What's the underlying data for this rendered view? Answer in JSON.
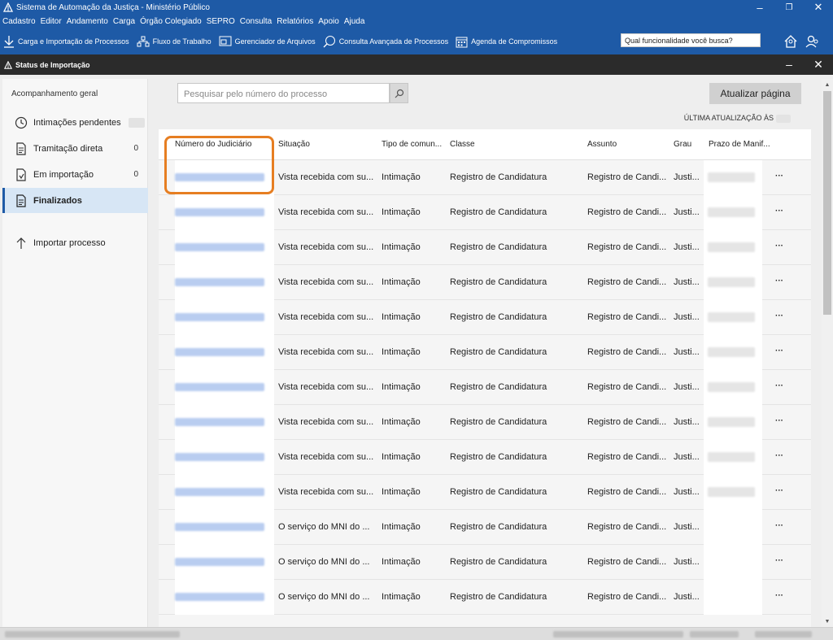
{
  "window": {
    "title": "Sistema de Automação da Justiça - Ministério Público",
    "minimize": "–",
    "maximize": "❐",
    "close": "✕"
  },
  "menu": {
    "items": [
      "Cadastro",
      "Editor",
      "Andamento",
      "Carga",
      "Órgão Colegiado",
      "SEPRO",
      "Consulta",
      "Relatórios",
      "Apoio",
      "Ajuda"
    ]
  },
  "toolbar": {
    "items": [
      {
        "label": "Carga e Importação de Processos",
        "icon": "download-icon"
      },
      {
        "label": "Fluxo de Trabalho",
        "icon": "workflow-icon"
      },
      {
        "label": "Gerenciador de Arquivos",
        "icon": "file-manager-icon"
      },
      {
        "label": "Consulta Avançada de Processos",
        "icon": "search-chat-icon"
      },
      {
        "label": "Agenda de Compromissos",
        "icon": "calendar-icon"
      }
    ],
    "search_placeholder": "Qual funcionalidade você busca?"
  },
  "panel": {
    "title": "Status de Importação",
    "minimize": "–",
    "close": "✕"
  },
  "sidebar": {
    "header": "Acompanhamento geral",
    "items": [
      {
        "label": "Intimações pendentes",
        "count": "",
        "icon": "clock-icon"
      },
      {
        "label": "Tramitação direta",
        "count": "0",
        "icon": "document-icon"
      },
      {
        "label": "Em importação",
        "count": "0",
        "icon": "document-import-icon"
      },
      {
        "label": "Finalizados",
        "count": "",
        "icon": "document-check-icon",
        "active": true
      }
    ],
    "import_label": "Importar processo"
  },
  "main": {
    "search_placeholder": "Pesquisar pelo número do processo",
    "refresh_label": "Atualizar página",
    "last_update_label": "ÚLTIMA ATUALIZAÇÃO ÀS"
  },
  "table": {
    "columns": [
      "Número do Judiciário",
      "Situação",
      "Tipo de comun...",
      "Classe",
      "Assunto",
      "Grau",
      "Prazo de Manif..."
    ],
    "rows": [
      {
        "situacao": "Vista recebida com su...",
        "tipo": "Intimação",
        "classe": "Registro de Candidatura",
        "assunto": "Registro de Candi...",
        "grau": "Justi...",
        "has_prazo": true
      },
      {
        "situacao": "Vista recebida com su...",
        "tipo": "Intimação",
        "classe": "Registro de Candidatura",
        "assunto": "Registro de Candi...",
        "grau": "Justi...",
        "has_prazo": true
      },
      {
        "situacao": "Vista recebida com su...",
        "tipo": "Intimação",
        "classe": "Registro de Candidatura",
        "assunto": "Registro de Candi...",
        "grau": "Justi...",
        "has_prazo": true
      },
      {
        "situacao": "Vista recebida com su...",
        "tipo": "Intimação",
        "classe": "Registro de Candidatura",
        "assunto": "Registro de Candi...",
        "grau": "Justi...",
        "has_prazo": true
      },
      {
        "situacao": "Vista recebida com su...",
        "tipo": "Intimação",
        "classe": "Registro de Candidatura",
        "assunto": "Registro de Candi...",
        "grau": "Justi...",
        "has_prazo": true
      },
      {
        "situacao": "Vista recebida com su...",
        "tipo": "Intimação",
        "classe": "Registro de Candidatura",
        "assunto": "Registro de Candi...",
        "grau": "Justi...",
        "has_prazo": true
      },
      {
        "situacao": "Vista recebida com su...",
        "tipo": "Intimação",
        "classe": "Registro de Candidatura",
        "assunto": "Registro de Candi...",
        "grau": "Justi...",
        "has_prazo": true
      },
      {
        "situacao": "Vista recebida com su...",
        "tipo": "Intimação",
        "classe": "Registro de Candidatura",
        "assunto": "Registro de Candi...",
        "grau": "Justi...",
        "has_prazo": true
      },
      {
        "situacao": "Vista recebida com su...",
        "tipo": "Intimação",
        "classe": "Registro de Candidatura",
        "assunto": "Registro de Candi...",
        "grau": "Justi...",
        "has_prazo": true
      },
      {
        "situacao": "Vista recebida com su...",
        "tipo": "Intimação",
        "classe": "Registro de Candidatura",
        "assunto": "Registro de Candi...",
        "grau": "Justi...",
        "has_prazo": true
      },
      {
        "situacao": "O serviço do MNI do ...",
        "tipo": "Intimação",
        "classe": "Registro de Candidatura",
        "assunto": "Registro de Candi...",
        "grau": "Justi...",
        "has_prazo": false
      },
      {
        "situacao": "O serviço do MNI do ...",
        "tipo": "Intimação",
        "classe": "Registro de Candidatura",
        "assunto": "Registro de Candi...",
        "grau": "Justi...",
        "has_prazo": false
      },
      {
        "situacao": "O serviço do MNI do ...",
        "tipo": "Intimação",
        "classe": "Registro de Candidatura",
        "assunto": "Registro de Candi...",
        "grau": "Justi...",
        "has_prazo": false
      }
    ],
    "row_action": "···"
  },
  "colors": {
    "brand_blue": "#1e5aa6",
    "panel_dark": "#2b2b2b",
    "highlight_orange": "#e67e22",
    "active_item_bg": "#d7e6f5"
  }
}
